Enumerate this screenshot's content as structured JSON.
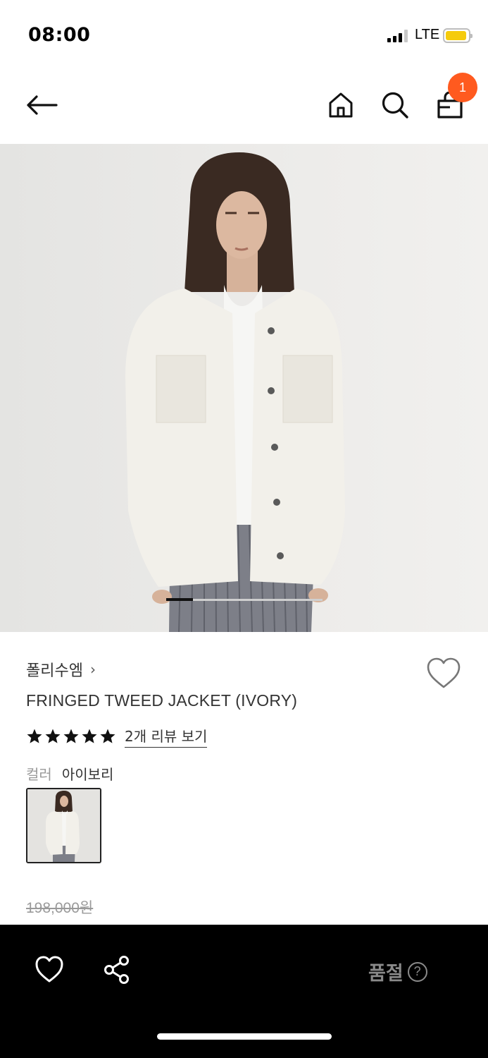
{
  "status_bar": {
    "time": "08:00",
    "network": "LTE",
    "battery_color": "#f5cb0c"
  },
  "nav": {
    "back_icon": "arrow-left-icon",
    "home_icon": "home-icon",
    "search_icon": "search-icon",
    "cart_icon": "shopping-bag-icon",
    "cart_count": "1",
    "badge_color": "#ff5a1f"
  },
  "product": {
    "brand": "폴리수엠",
    "brand_chevron": "›",
    "title": "FRINGED TWEED JACKET (IVORY)",
    "rating_stars": 5,
    "review_link": "2개 리뷰 보기",
    "color_label": "컬러",
    "color_value": "아이보리",
    "price": "198,000원",
    "carousel": {
      "current": 1,
      "total": 6
    }
  },
  "bottom_bar": {
    "wish_icon": "heart-outline-icon",
    "share_icon": "share-icon",
    "status_label": "품절",
    "help_icon": "?",
    "bar_color": "#000000"
  }
}
